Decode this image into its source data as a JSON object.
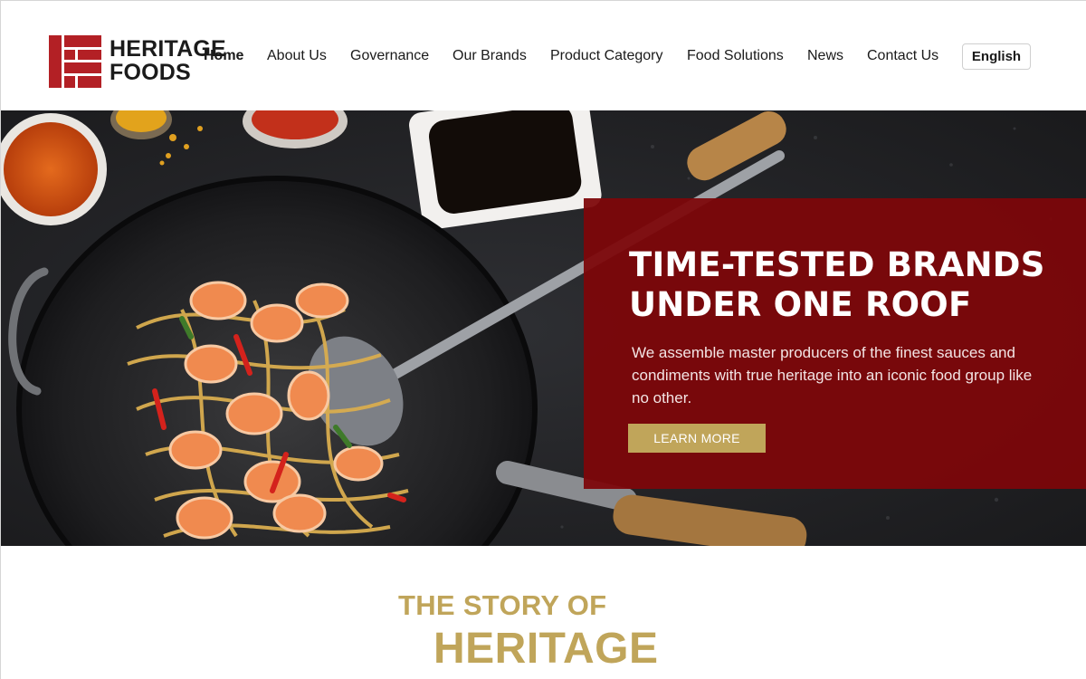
{
  "brand": {
    "name_line1": "HERITAGE",
    "name_line2": "FOODS"
  },
  "nav": {
    "items": [
      {
        "label": "Home",
        "active": true
      },
      {
        "label": "About Us"
      },
      {
        "label": "Governance"
      },
      {
        "label": "Our Brands"
      },
      {
        "label": "Product Category"
      },
      {
        "label": "Food Solutions"
      },
      {
        "label": "News"
      },
      {
        "label": "Contact Us"
      }
    ],
    "language": "English"
  },
  "hero": {
    "title_line1": "TIME-TESTED BRANDS",
    "title_line2": "UNDER ONE ROOF",
    "description": "We assemble master producers of the finest sauces and condiments with true heritage into an iconic food group like no other.",
    "cta_label": "LEARN MORE"
  },
  "story": {
    "kicker": "THE STORY OF",
    "title": "HERITAGE"
  },
  "colors": {
    "brand_red": "#b32025",
    "panel_red": "#7d060a",
    "gold": "#c0a55a",
    "text_dark": "#1a1a1a"
  }
}
